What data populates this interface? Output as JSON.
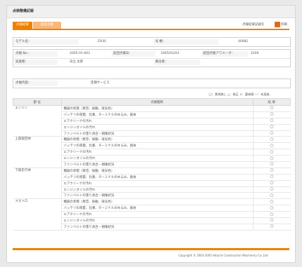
{
  "header": {
    "title": "点検整備記録"
  },
  "tabs": [
    {
      "label": "点検結果"
    },
    {
      "label": "部品交換"
    }
  ],
  "print": {
    "label": "点検結果記録を",
    "icon": "print-icon",
    "icon_label": "印刷"
  },
  "machine": {
    "model_label": "モデル名：",
    "model_value": "ZX30",
    "serial_label": "号 機：",
    "serial_value": "40081"
  },
  "records": {
    "r1": [
      {
        "label": "点検 No.：",
        "value": "2005-01-003"
      },
      {
        "label": "前回点検日：",
        "value": "2005/01/03"
      },
      {
        "label": "前回点検アワメータ：",
        "value": "2200"
      }
    ],
    "r2": [
      {
        "label": "実施者：",
        "value": "日立 太郎"
      },
      {
        "label": "責任者：",
        "value": ""
      }
    ]
  },
  "inspection_type": {
    "label": "点検内容：",
    "value": "定期サービス"
  },
  "legend": "◯：異常無し △：修正 ×：要修理 ―：未実施",
  "table": {
    "headers": [
      "部 位",
      "点検箇所",
      "結 果"
    ],
    "groups": [
      {
        "name": "エンジン",
        "items": [
          {
            "text": "機器の状態（異音、振動、排気色）",
            "result": "◯"
          },
          {
            "text": "バッテリの液量、比重、ターミナルのゆるみ、腐食",
            "result": "◯"
          },
          {
            "text": "エアクリーナの汚れ",
            "result": "◯"
          },
          {
            "text": "エンジンオイルの汚れ",
            "result": "◯"
          },
          {
            "text": "ファンベルトの張り具合・損傷状況",
            "result": "◯"
          }
        ]
      },
      {
        "name": "上部旋回体",
        "items": [
          {
            "text": "機器の状態（異音、振動、排気色）",
            "result": "◯"
          },
          {
            "text": "バッテリの液量、比重、ターミナルのゆるみ、腐食",
            "result": "◯"
          },
          {
            "text": "エアクリーナの汚れ",
            "result": "◯"
          },
          {
            "text": "エンジンオイルの汚れ",
            "result": "◯"
          },
          {
            "text": "ファンベルトの張り具合・損傷状況",
            "result": "◯"
          }
        ]
      },
      {
        "name": "下部走行体",
        "items": [
          {
            "text": "機器の状態（異音、振動、排気色）",
            "result": "◯"
          },
          {
            "text": "バッテリの液量、比重、ターミナルのゆるみ、腐食",
            "result": "◯"
          },
          {
            "text": "エアクリーナの汚れ",
            "result": "◯"
          },
          {
            "text": "エンジンオイルの汚れ",
            "result": "◯"
          },
          {
            "text": "ファンベルトの張り具合・損傷状況",
            "result": "◯"
          }
        ]
      },
      {
        "name": "メカトロ",
        "items": [
          {
            "text": "機器の状態（異音、振動、排気色）",
            "result": "◯"
          },
          {
            "text": "バッテリの液量、比重、ターミナルのゆるみ、腐食",
            "result": "◯"
          },
          {
            "text": "エアクリーナの汚れ",
            "result": "◯"
          },
          {
            "text": "エンジンオイルの汚れ",
            "result": "◯"
          },
          {
            "text": "ファンベルトの張り具合・損傷状況",
            "result": "◯"
          }
        ]
      }
    ]
  },
  "footer": {
    "copyright": "Copyright © 2003-2005 Hitachi Construction Machinery Co.,Ltd."
  },
  "colors": {
    "accent": "#f08000",
    "accent_light": "#f7b779"
  }
}
